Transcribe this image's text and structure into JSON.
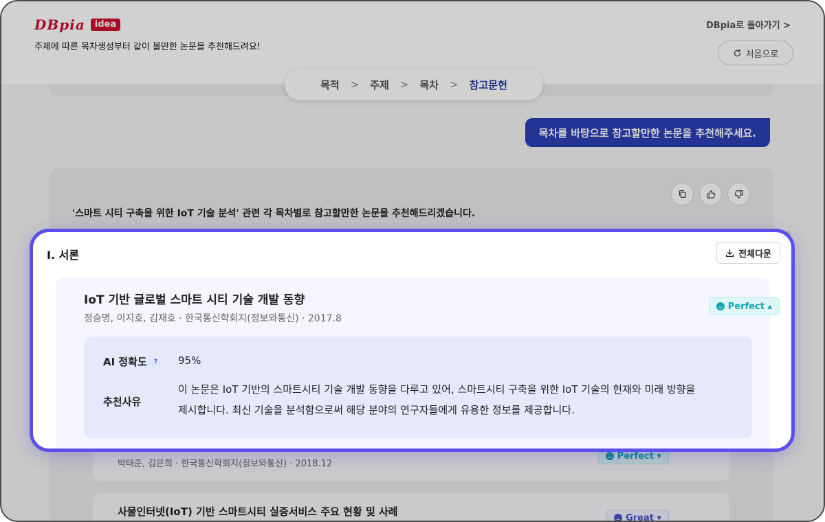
{
  "header": {
    "logo_main": "DBpia",
    "logo_badge": "idea",
    "tagline": "주제에 따른 목차생성부터 같이 볼만한 논문을 추천해드려요!",
    "back_link": "DBpia로 돌아가기 >",
    "restart_label": "처음으로"
  },
  "steps": [
    {
      "label": "목적",
      "active": false
    },
    {
      "label": "주제",
      "active": false
    },
    {
      "label": "목차",
      "active": false
    },
    {
      "label": "참고문헌",
      "active": true
    }
  ],
  "step_separator": ">",
  "chat": {
    "user_message": "목차를 바탕으로 참고할만한 논문을 추천해주세요.",
    "bot_intro": "'스마트 시티 구축을 위한 IoT 기술 분석' 관련 각 목차별로 참고할만한 논문을 추천해드리겠습니다."
  },
  "section": {
    "title": "I. 서론",
    "download_label": "전체다운"
  },
  "papers": [
    {
      "title": "IoT 기반 글로벌 스마트 시티 기술 개발 동향",
      "meta": "정승명, 이지호, 김재호 · 한국통신학회지(정보와통신) · 2017.8",
      "badge": "Perfect ▴",
      "accuracy_label": "AI 정확도",
      "accuracy_help": "?",
      "accuracy_value": "95%",
      "reason_label": "추천사유",
      "reason_line1": "이 논문은 IoT 기반의 스마트시티 기술 개발 동향을 다루고 있어, 스마트시티 구축을 위한 IoT 기술의 현재와 미래 방향을",
      "reason_line2": "제시합니다. 최신 기술을 분석함으로써 해당 분야의 연구자들에게 유용한 정보를 제공합니다."
    },
    {
      "title": "",
      "meta": "박태준, 김은희 · 한국통신학회지(정보와통신) · 2018.12",
      "badge": "Perfect ▾"
    },
    {
      "title": "사물인터넷(IoT) 기반 스마트시티 실증서비스 주요 현황 및 사례",
      "meta": "",
      "badge": "Great ▾"
    }
  ],
  "colors": {
    "brand_red": "#c8102e",
    "primary_blue": "#2c40b6",
    "focus_border": "#5b4ff0",
    "perfect_teal": "#13a6b1",
    "great_indigo": "#4a56c6"
  }
}
